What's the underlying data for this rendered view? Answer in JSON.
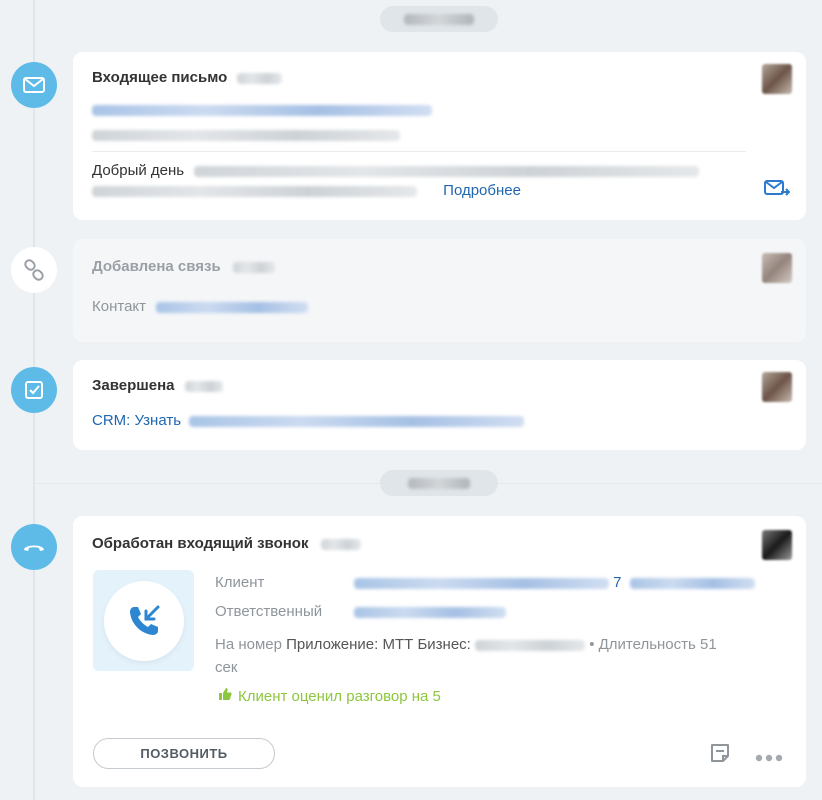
{
  "colors": {
    "accent": "#5ebbe8",
    "link": "#2067b0",
    "rating": "#8dc63f",
    "background": "#eef2f4"
  },
  "date_separators": [
    {
      "label": "",
      "blurred": true
    },
    {
      "label": "",
      "blurred": true
    }
  ],
  "events": {
    "email": {
      "icon": "envelope-icon",
      "title": "Входящее письмо",
      "body_start": "Добрый день",
      "more_link": "Подробнее",
      "action_icon": "email-reply-icon"
    },
    "link_added": {
      "icon": "link-chain-icon",
      "title": "Добавлена связь",
      "contact_label": "Контакт"
    },
    "completed": {
      "icon": "checkbox-icon",
      "title": "Завершена",
      "task_link_start": "CRM: Узнать"
    },
    "call": {
      "icon": "phone-hangup-icon",
      "title": "Обработан входящий звонок",
      "client_label": "Клиент",
      "client_phone_visible": "7",
      "responsible_label": "Ответственный",
      "number_label": "На номер",
      "number_value": "Приложение: МТТ Бизнес:",
      "separator": "•",
      "duration_label": "Длительность 51",
      "duration_unit": "сек",
      "rating_icon": "thumbs-up-icon",
      "rating_text": "Клиент оценил разговор на 5",
      "call_button": "ПОЗВОНИТЬ",
      "note_icon": "note-icon",
      "more_icon": "more-dots-icon",
      "incoming_icon": "incoming-call-icon"
    }
  }
}
